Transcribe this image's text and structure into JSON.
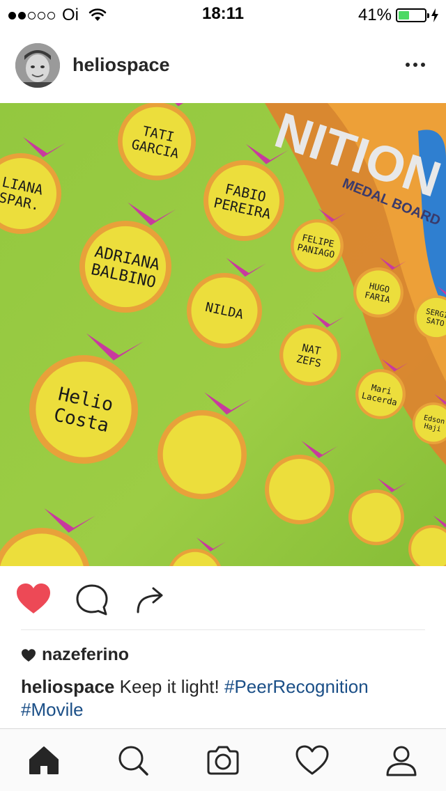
{
  "status_bar": {
    "carrier": "Oi",
    "signal_bars_filled": 2,
    "signal_bars_total": 5,
    "time": "18:11",
    "battery_percent": "41%",
    "battery_level": 0.41,
    "battery_color": "#4cd964"
  },
  "post": {
    "username": "heliospace",
    "more_icon": "more-horizontal-icon",
    "photo": {
      "board_title": "NITION",
      "board_subtitle": "MEDAL BOARD",
      "medals": [
        {
          "text": "LIANA\nSPAR."
        },
        {
          "text": "TATI\nGARCIA"
        },
        {
          "text": "FABIO\nPEREIRA"
        },
        {
          "text": "ADRIANA\nBALBINO"
        },
        {
          "text": "FELIPE\nPANIAGO"
        },
        {
          "text": "NILDA"
        },
        {
          "text": "HUGO\nFARIA"
        },
        {
          "text": "SERGI\nSATO"
        },
        {
          "text": "NAT\nZEFS"
        },
        {
          "text": "Helio\nCosta"
        },
        {
          "text": "Mari\nLacerda"
        },
        {
          "text": "Edson\nHaji"
        }
      ]
    },
    "actions": {
      "like_icon": "heart-filled-icon",
      "comment_icon": "comment-icon",
      "share_icon": "share-icon"
    },
    "likes": {
      "icon": "heart-icon",
      "name": "nazeferino"
    },
    "caption": {
      "username": "heliospace",
      "text": "Keep it light!",
      "hashtags": [
        "#PeerRecognition",
        "#Movile"
      ]
    },
    "colors": {
      "like": "#ed4956",
      "hashtag": "#1b4f87"
    }
  },
  "tab_bar": {
    "items": [
      {
        "icon": "home-icon",
        "selected": true
      },
      {
        "icon": "search-icon",
        "selected": false
      },
      {
        "icon": "camera-icon",
        "selected": false
      },
      {
        "icon": "heart-outline-icon",
        "selected": false
      },
      {
        "icon": "profile-icon",
        "selected": false
      }
    ]
  }
}
